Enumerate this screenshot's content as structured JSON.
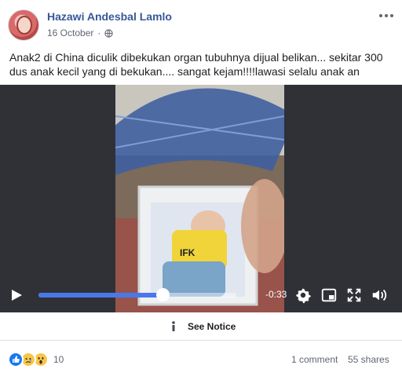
{
  "post": {
    "author": "Hazawi Andesbal Lamlo",
    "date": "16 October",
    "separator": "·",
    "caption": "Anak2 di China diculik dibekukan organ tubuhnya dijual belikan... sekitar 300 dus anak kecil yang di bekukan.... sangat kejam!!!!lawasi selalu anak an"
  },
  "video": {
    "time_remaining": "-0:33",
    "progress": 0.63,
    "shirt_text": "IFK",
    "icons": [
      "play-icon",
      "gear-icon",
      "pip-icon",
      "fullscreen-icon",
      "volume-icon"
    ]
  },
  "notice": {
    "label": "See Notice",
    "icon": "info-icon"
  },
  "footer": {
    "reaction_icons": [
      "like-icon",
      "sad-icon",
      "wow-icon"
    ],
    "reaction_count": "10",
    "comments": "1 comment",
    "shares": "55 shares"
  },
  "colors": {
    "author": "#385898",
    "like": "#1877f2",
    "reaction_yellow": "#f7c64c",
    "progress": "#4a78ea"
  }
}
